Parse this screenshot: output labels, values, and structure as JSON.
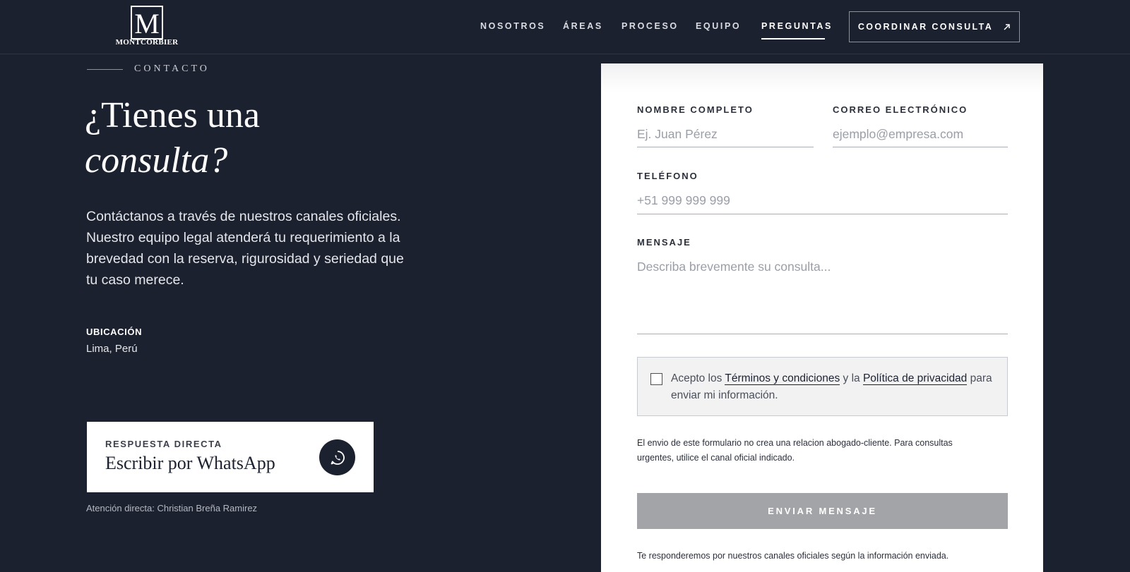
{
  "header": {
    "brand_letter": "M",
    "brand_name": "MONTCORBIER",
    "nav": [
      {
        "label": "NOSOTROS"
      },
      {
        "label": "ÁREAS"
      },
      {
        "label": "PROCESO"
      },
      {
        "label": "EQUIPO"
      },
      {
        "label": "PREGUNTAS",
        "active": true
      }
    ],
    "cta_label": "COORDINAR CONSULTA",
    "cta_icon": "arrow-up-right-icon"
  },
  "contact": {
    "eyebrow": "CONTACTO",
    "headline_line1": "¿Tienes una",
    "headline_line2": "consulta?",
    "intro": "Contáctanos a través de nuestros canales oficiales. Nuestro equipo legal atenderá tu requerimiento a la brevedad con la reserva, rigurosidad y seriedad que tu caso merece.",
    "location_label": "UBICACIÓN",
    "location_value": "Lima, Perú",
    "whatsapp": {
      "label": "RESPUESTA DIRECTA",
      "title": "Escribir por WhatsApp",
      "icon": "whatsapp-icon"
    },
    "direct_attention": "Atención directa: Christian Breña Ramirez"
  },
  "form": {
    "name_label": "NOMBRE COMPLETO",
    "name_placeholder": "Ej. Juan Pérez",
    "email_label": "CORREO ELECTRÓNICO",
    "email_placeholder": "ejemplo@empresa.com",
    "phone_label": "TELÉFONO",
    "phone_placeholder": "+51 999 999 999",
    "message_label": "MENSAJE",
    "message_placeholder": "Describa brevemente su consulta...",
    "consent": {
      "prefix": "Acepto los ",
      "terms_link": "Términos y condiciones",
      "middle": " y la ",
      "privacy_link": "Política de privacidad",
      "suffix": " para enviar mi información.",
      "checked": false
    },
    "disclaimer": "El envio de este formulario no crea una relacion abogado-cliente. Para consultas urgentes, utilice el canal oficial indicado.",
    "submit_label": "ENVIAR MENSAJE",
    "response_note": "Te responderemos por nuestros canales oficiales según la información enviada."
  },
  "colors": {
    "background": "#1c2130",
    "panel": "#ffffff",
    "submit_disabled": "#a3a4a7"
  }
}
